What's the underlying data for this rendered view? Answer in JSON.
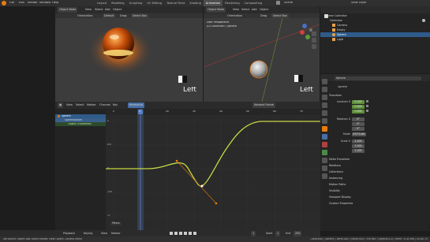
{
  "menubar": {
    "menus": [
      "File",
      "Edit",
      "Render",
      "Window",
      "Help"
    ],
    "workspaces": [
      "Layout",
      "Modeling",
      "Sculpting",
      "UV Editing",
      "Texture Paint",
      "Shading",
      "Animation",
      "Rendering",
      "Compositing"
    ],
    "active_workspace": "Animation",
    "scene": "Scene",
    "view_layer": "View Layer"
  },
  "viewport_left": {
    "mode": "Object Mode",
    "view": "View",
    "select": "Select",
    "add": "Add",
    "object": "Object",
    "orientation": "Orientation:",
    "orientation_value": "Default",
    "drag": "Drag:",
    "drag_value": "Select Box",
    "corner_label": "Left"
  },
  "viewport_right": {
    "mode": "Object Mode",
    "view": "View",
    "select": "Select",
    "add": "Add",
    "object": "Object",
    "orientation": "Orientation",
    "drag": "Drag",
    "drag_value": "Select Box",
    "info_line1": "User Perspective",
    "info_line2": "(0) Collection | Sphere",
    "corner_label": "Left"
  },
  "outliner": {
    "title": "Scene Collection",
    "items": [
      "Collection",
      "Camera",
      "Empty",
      "Sphere",
      "Light"
    ]
  },
  "properties": {
    "object_name": "Sphere",
    "data_name": "Sphere",
    "transform": "Transform",
    "location_label": "Location X",
    "location": [
      "0.000",
      "0.000",
      "0.000"
    ],
    "rotation_label": "Rotation X",
    "rotation": [
      "0°",
      "0°",
      "0°"
    ],
    "mode_label": "Mode",
    "mode_value": "XYZ Euler",
    "scale_label": "Scale X",
    "scale": [
      "1.000",
      "1.000",
      "1.000"
    ],
    "sections": [
      "Delta Transform",
      "Relations",
      "Collections",
      "Instancing",
      "Motion Paths",
      "Visibility",
      "Viewport Display",
      "Custom Properties"
    ]
  },
  "graph_editor": {
    "mode": "Graph Editor",
    "view": "View",
    "select": "Select",
    "marker": "Marker",
    "channel": "Channel",
    "key": "Key",
    "normalize": "Normalize",
    "pivot": "Nearest Frame",
    "channels": [
      "Sphere",
      "SphereAction",
      "Object Transforms"
    ],
    "x_ticks": [
      "0",
      "10",
      "20",
      "30",
      "40",
      "50",
      "60",
      "70",
      "80"
    ],
    "y_ticks": [
      "1",
      "0.5",
      "0",
      "-0.5",
      "-1"
    ],
    "current_frame": "1",
    "filter_label": "Filters"
  },
  "timeline": {
    "playback": "Playback",
    "keying": "Keying",
    "view": "View",
    "marker": "Marker",
    "frame": "1",
    "start_label": "Start",
    "start": "1",
    "end_label": "End",
    "end": "250"
  },
  "statusbar": {
    "left": "Set Active Object  Box Select  Rotate View  Object Context Menu",
    "right": "Collection | Sphere | Verts:482 | Faces:500 | Tris:960 | Objects:1/4 | Mem: 31.8 MiB | v2.80.75"
  },
  "colors": {
    "curve": "#c6d843",
    "accent": "#e87d0d",
    "selected": "#2e5b8a",
    "playhead": "#5680c2"
  }
}
